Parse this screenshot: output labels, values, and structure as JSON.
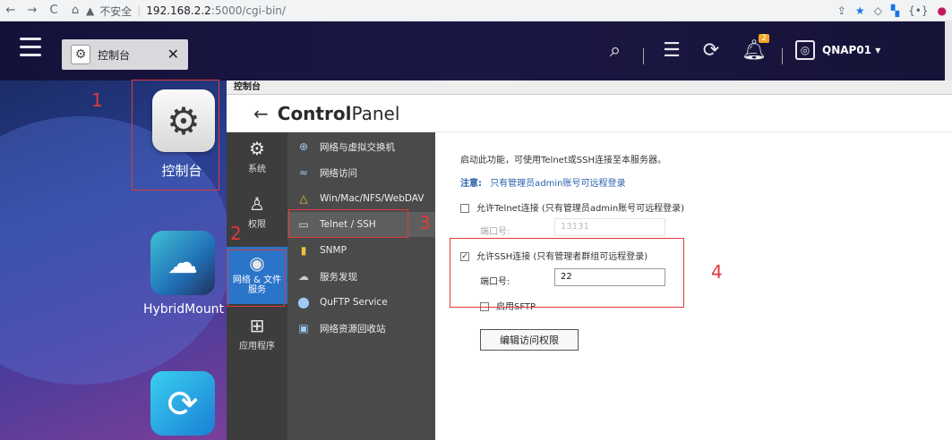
{
  "browser": {
    "url_warning": "不安全",
    "url_host": "192.168.2.2",
    "url_path": ":5000/cgi-bin/",
    "nav": [
      "←",
      "→",
      "C",
      "⌂"
    ]
  },
  "topbar": {
    "tab_label": "控制台",
    "tab_close": "✕",
    "notification_count": "2",
    "user_name": "QNAP01 ▾"
  },
  "desktop": {
    "apps": [
      {
        "label": "控制台"
      },
      {
        "label": "HybridMount"
      },
      {
        "label": ""
      }
    ]
  },
  "annotations": [
    "1",
    "2",
    "3",
    "4"
  ],
  "control_panel": {
    "window_title": "控制台",
    "header_bold": "Control",
    "header_light": "Panel",
    "categories": [
      {
        "label": "系统",
        "icon": "gear-icon"
      },
      {
        "label": "权限",
        "icon": "user-icon"
      },
      {
        "label": "网络 & 文件服务",
        "icon": "globe-icon",
        "active": true
      },
      {
        "label": "应用程序",
        "icon": "apps-icon"
      }
    ],
    "sub_items": [
      {
        "label": "网络与虚拟交换机",
        "icon": "network-icon"
      },
      {
        "label": "网络访问",
        "icon": "network-access-icon"
      },
      {
        "label": "Win/Mac/NFS/WebDAV",
        "icon": "file-share-icon"
      },
      {
        "label": "Telnet / SSH",
        "icon": "terminal-icon",
        "active": true
      },
      {
        "label": "SNMP",
        "icon": "snmp-icon"
      },
      {
        "label": "服务发现",
        "icon": "discovery-icon"
      },
      {
        "label": "QuFTP Service",
        "icon": "ftp-icon"
      },
      {
        "label": "网络资源回收站",
        "icon": "recycle-icon"
      }
    ],
    "content": {
      "intro": "启动此功能，可使用Telnet或SSH连接至本服务器。",
      "note_label": "注意:",
      "note_text": "只有管理员admin账号可远程登录",
      "telnet_label": "允许Telnet连接 (只有管理员admin账号可远程登录)",
      "telnet_port_label": "端口号:",
      "telnet_port_value": "13131",
      "ssh_label": "允许SSH连接 (只有管理者群组可远程登录)",
      "ssh_port_label": "端口号:",
      "ssh_port_value": "22",
      "sftp_label": "启用SFTP",
      "edit_button": "编辑访问权限"
    }
  }
}
